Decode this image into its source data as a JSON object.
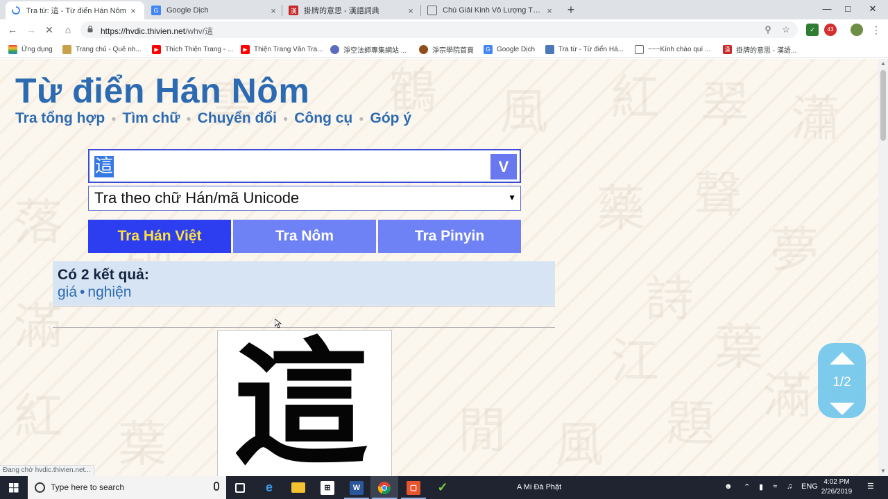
{
  "browser": {
    "tabs": [
      {
        "title": "Tra từ: 這 - Từ điển Hán Nôm",
        "favicon": "loading-spinner-icon",
        "active": true
      },
      {
        "title": "Google Dịch",
        "favicon": "google-translate-icon",
        "active": false
      },
      {
        "title": "掛牌的意思 - 漢語詞典",
        "favicon": "hanyu-cidian-icon",
        "active": false
      },
      {
        "title": "Chú Giải Kinh Vô Lượng Thọ - Ph",
        "favicon": "page-icon",
        "active": false
      }
    ],
    "new_tab_glyph": "+",
    "url_host": "https://hvdic.thivien.net",
    "url_path": "/whv/這",
    "bookmarks": [
      {
        "label": "Ứng dụng",
        "icon": "apps-grid-icon"
      },
      {
        "label": "Trang chủ - Quê nh...",
        "icon": "site-icon"
      },
      {
        "label": "Thích Thiện Trang - ...",
        "icon": "youtube-icon"
      },
      {
        "label": "Thiện Trang Vân Tra...",
        "icon": "youtube-icon"
      },
      {
        "label": "淨空法師專集網站 ...",
        "icon": "amitabha-site-icon"
      },
      {
        "label": "淨宗學院首頁",
        "icon": "pure-land-icon"
      },
      {
        "label": "Google Dịch",
        "icon": "google-translate-icon"
      },
      {
        "label": "Tra từ - Từ điển Há...",
        "icon": "hvdic-icon"
      },
      {
        "label": "~~~Kính chào quí ...",
        "icon": "page-icon"
      },
      {
        "label": "掛牌的意思 - 漢語...",
        "icon": "hanyu-cidian-icon"
      }
    ],
    "extension_badge": "43",
    "status_text": "Đang chờ hvdic.thivien.net..."
  },
  "site": {
    "title": "Từ điển Hán Nôm",
    "nav": [
      "Tra tổng hợp",
      "Tìm chữ",
      "Chuyển đổi",
      "Công cụ",
      "Góp ý"
    ],
    "query_value": "這",
    "submit_label": "V",
    "mode_select": "Tra theo chữ Hán/mã Unicode",
    "search_buttons": [
      "Tra Hán Việt",
      "Tra Nôm",
      "Tra Pinyin"
    ],
    "result_count_text": "Có 2 kết quả:",
    "results": [
      "giá",
      "nghiện"
    ],
    "result_separator": "•",
    "glyph": "這",
    "pager": "1/2"
  },
  "taskbar": {
    "search_placeholder": "Type here to search",
    "running_label": "A Mi Đà Phật",
    "language": "ENG",
    "time": "4:02 PM",
    "date": "2/26/2019"
  },
  "colors": {
    "site_blue": "#2c6bb1",
    "active_button": "#2c3ef0",
    "active_button_text": "#ffe33b",
    "inactive_button": "#6f82f5",
    "result_bg": "#d7e4f3",
    "pager_bg": "#6fc7ec"
  }
}
